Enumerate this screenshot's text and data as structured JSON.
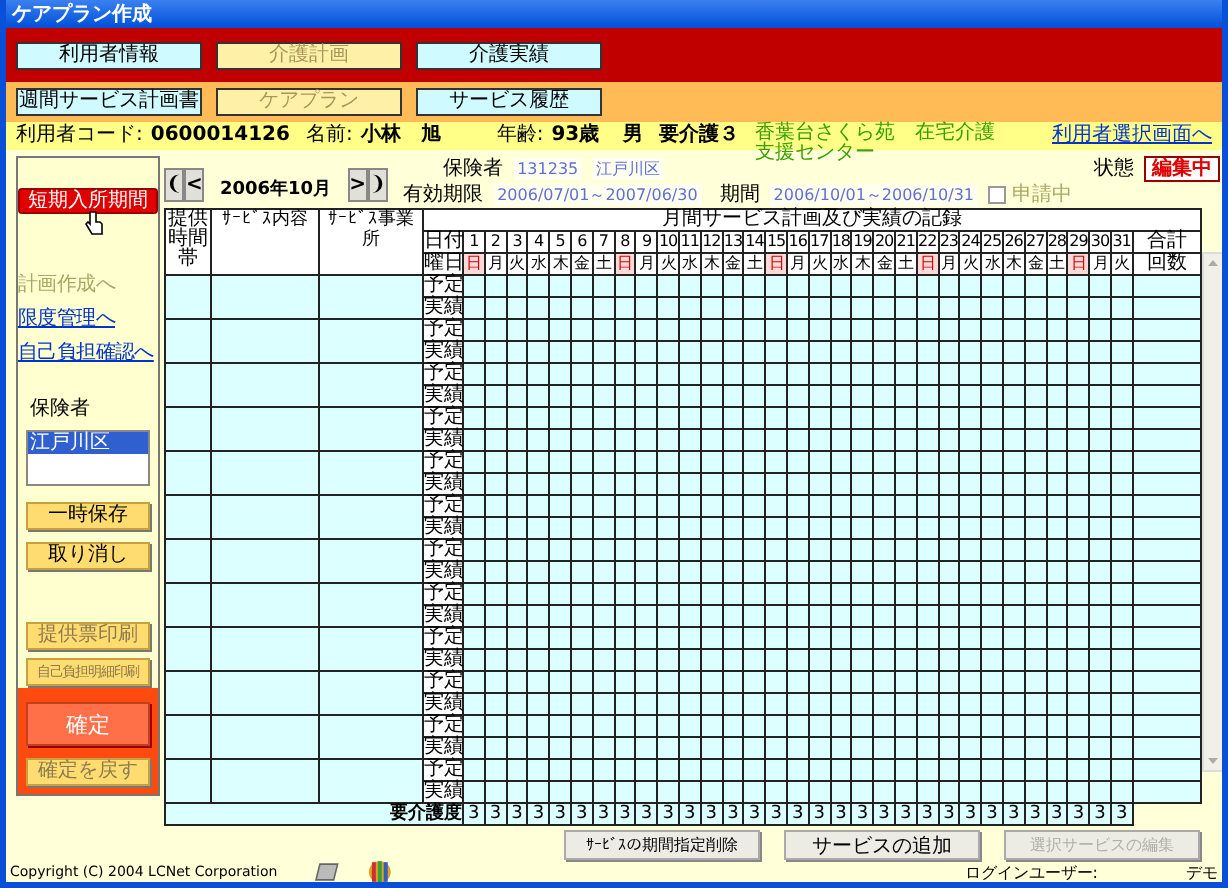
{
  "window": {
    "title": "ケアプラン作成"
  },
  "main_tabs": [
    {
      "label": "利用者情報",
      "selected": false
    },
    {
      "label": "介護計画",
      "selected": true
    },
    {
      "label": "介護実績",
      "selected": false
    }
  ],
  "sub_tabs": [
    {
      "label": "週間サービス計画書",
      "selected": false
    },
    {
      "label": "ケアプラン",
      "selected": true
    },
    {
      "label": "サービス履歴",
      "selected": false
    }
  ],
  "user_info": {
    "code_label": "利用者コード:",
    "code": "0600014126",
    "name_label": "名前:",
    "name": "小林　旭",
    "age_label": "年齢:",
    "age": "93歳",
    "sex": "男",
    "care_level": "要介護３",
    "provider": "香葉台さくら苑　在宅介護支援センター",
    "back_link": "利用者選択画面へ"
  },
  "sidebar": {
    "top_button": "短期入所期間",
    "links": [
      {
        "label": "計画作成へ",
        "disabled": true
      },
      {
        "label": "限度管理へ",
        "disabled": false
      },
      {
        "label": "自己負担確認へ",
        "disabled": false
      }
    ],
    "insurer_label": "保険者",
    "insurer_list": [
      {
        "label": "江戸川区",
        "selected": true
      }
    ],
    "save_buttons": [
      {
        "label": "一時保存",
        "disabled": false
      },
      {
        "label": "取り消し",
        "disabled": false
      }
    ],
    "print_buttons": [
      {
        "label": "提供票印刷",
        "disabled": true
      },
      {
        "label": "自己負担明細印刷",
        "disabled": true
      }
    ],
    "confirm": {
      "label": "確定",
      "disabled": false
    },
    "undo_confirm": {
      "label": "確定を戻す",
      "disabled": true
    }
  },
  "month_nav": {
    "first": "❨",
    "prev": "<",
    "month": "2006年10月",
    "next": ">",
    "last": "❩"
  },
  "insurer": {
    "label": "保険者",
    "number": "131235",
    "name": "江戸川区"
  },
  "validity": {
    "label": "有効期限",
    "value": "2006/07/01～2007/06/30"
  },
  "period": {
    "label": "期間",
    "value": "2006/10/01～2006/10/31"
  },
  "application": {
    "label": "申請中",
    "checked": false,
    "disabled": true
  },
  "status": {
    "label": "状態",
    "value": "編集中"
  },
  "table": {
    "title": "月間サービス計画及び実績の記録",
    "columns": [
      "提供時間帯",
      "ｻｰﾋﾞｽ内容",
      "ｻｰﾋﾞｽ事業所"
    ],
    "date_label": "日付",
    "weekday_label": "曜日",
    "total_label": "合計",
    "count_label": "回数",
    "days": [
      {
        "day": "1",
        "weekday": "日",
        "sunday": true
      },
      {
        "day": "2",
        "weekday": "月",
        "sunday": false
      },
      {
        "day": "3",
        "weekday": "火",
        "sunday": false
      },
      {
        "day": "4",
        "weekday": "水",
        "sunday": false
      },
      {
        "day": "5",
        "weekday": "木",
        "sunday": false
      },
      {
        "day": "6",
        "weekday": "金",
        "sunday": false
      },
      {
        "day": "7",
        "weekday": "土",
        "sunday": false
      },
      {
        "day": "8",
        "weekday": "日",
        "sunday": true
      },
      {
        "day": "9",
        "weekday": "月",
        "sunday": false
      },
      {
        "day": "10",
        "weekday": "火",
        "sunday": false
      },
      {
        "day": "11",
        "weekday": "水",
        "sunday": false
      },
      {
        "day": "12",
        "weekday": "木",
        "sunday": false
      },
      {
        "day": "13",
        "weekday": "金",
        "sunday": false
      },
      {
        "day": "14",
        "weekday": "土",
        "sunday": false
      },
      {
        "day": "15",
        "weekday": "日",
        "sunday": true
      },
      {
        "day": "16",
        "weekday": "月",
        "sunday": false
      },
      {
        "day": "17",
        "weekday": "火",
        "sunday": false
      },
      {
        "day": "18",
        "weekday": "水",
        "sunday": false
      },
      {
        "day": "19",
        "weekday": "木",
        "sunday": false
      },
      {
        "day": "20",
        "weekday": "金",
        "sunday": false
      },
      {
        "day": "21",
        "weekday": "土",
        "sunday": false
      },
      {
        "day": "22",
        "weekday": "日",
        "sunday": true
      },
      {
        "day": "23",
        "weekday": "月",
        "sunday": false
      },
      {
        "day": "24",
        "weekday": "火",
        "sunday": false
      },
      {
        "day": "25",
        "weekday": "水",
        "sunday": false
      },
      {
        "day": "26",
        "weekday": "木",
        "sunday": false
      },
      {
        "day": "27",
        "weekday": "金",
        "sunday": false
      },
      {
        "day": "28",
        "weekday": "土",
        "sunday": false
      },
      {
        "day": "29",
        "weekday": "日",
        "sunday": true
      },
      {
        "day": "30",
        "weekday": "月",
        "sunday": false
      },
      {
        "day": "31",
        "weekday": "火",
        "sunday": false
      }
    ],
    "rows": [
      {
        "plan_label": "予定",
        "actual_label": "実績"
      },
      {
        "plan_label": "予定",
        "actual_label": "実績"
      },
      {
        "plan_label": "予定",
        "actual_label": "実績"
      },
      {
        "plan_label": "予定",
        "actual_label": "実績"
      },
      {
        "plan_label": "予定",
        "actual_label": "実績"
      },
      {
        "plan_label": "予定",
        "actual_label": "実績"
      },
      {
        "plan_label": "予定",
        "actual_label": "実績"
      },
      {
        "plan_label": "予定",
        "actual_label": "実績"
      },
      {
        "plan_label": "予定",
        "actual_label": "実績"
      },
      {
        "plan_label": "予定",
        "actual_label": "実績"
      },
      {
        "plan_label": "予定",
        "actual_label": "実績"
      },
      {
        "plan_label": "予定",
        "actual_label": "実績"
      }
    ],
    "care_level_label": "要介護度",
    "care_levels": [
      "3",
      "3",
      "3",
      "3",
      "3",
      "3",
      "3",
      "3",
      "3",
      "3",
      "3",
      "3",
      "3",
      "3",
      "3",
      "3",
      "3",
      "3",
      "3",
      "3",
      "3",
      "3",
      "3",
      "3",
      "3",
      "3",
      "3",
      "3",
      "3",
      "3",
      "3"
    ]
  },
  "actions": [
    {
      "label": "ｻｰﾋﾞｽの期間指定削除",
      "disabled": false
    },
    {
      "label": "サービスの追加",
      "disabled": false
    },
    {
      "label": "選択サービスの編集",
      "disabled": true
    }
  ],
  "footer": {
    "copyright": "Copyright (C) 2004 LCNet Corporation",
    "login_label": "ログインユーザー:",
    "login_user": "デモ"
  }
}
